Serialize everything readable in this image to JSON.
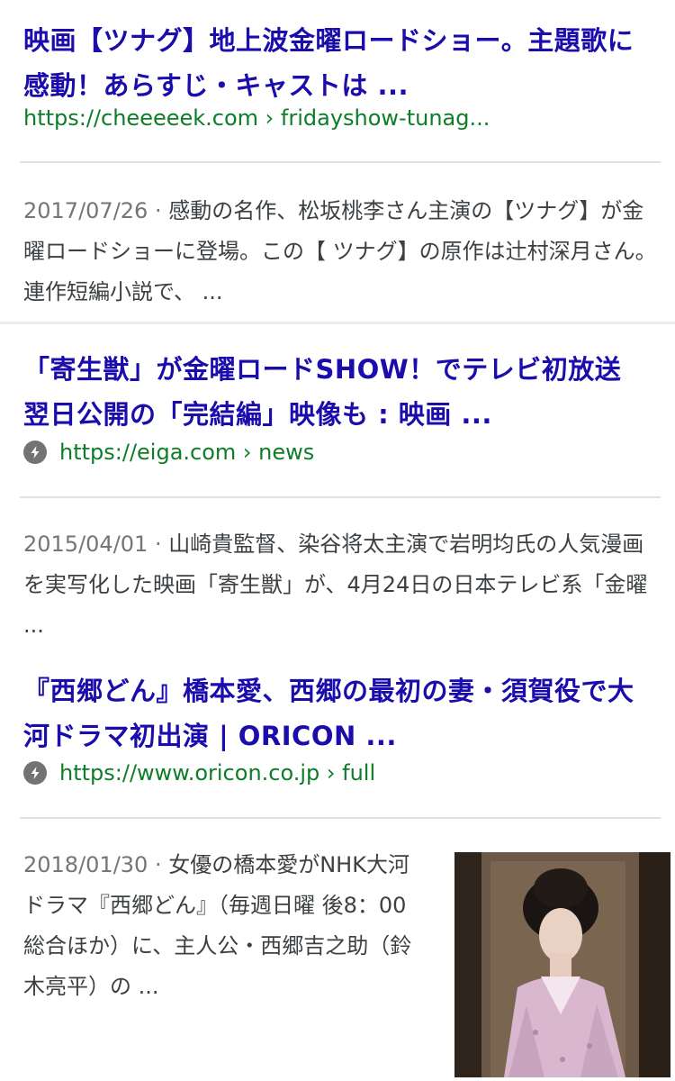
{
  "results": [
    {
      "title": "映画【ツナグ】地上波金曜ロードショー。主題歌に感動！あらすじ・キャストは ...",
      "url": "https://cheeeeek.com › fridayshow-tunag...",
      "date": "2017/07/26 · ",
      "snippet": "感動の名作、松坂桃李さん主演の【ツナグ】が金曜ロードショーに登場。この【 ツナグ】の原作は辻村深月さん。連作短編小説で、 ..."
    },
    {
      "title": "「寄生獣」が金曜ロードSHOW！でテレビ初放送 翌日公開の「完結編」映像も : 映画 ...",
      "url": "https://eiga.com › news",
      "date": "2015/04/01 · ",
      "snippet": "山崎貴監督、染谷将太主演で岩明均氏の人気漫画を実写化した映画「寄生獣」が、4月24日の日本テレビ系「金曜 ..."
    },
    {
      "title": "『西郷どん』橋本愛、西郷の最初の妻・須賀役で大河ドラマ初出演 | ORICON ...",
      "url": "https://www.oricon.co.jp › full",
      "date": "2018/01/30 · ",
      "snippet": "女優の橋本愛がNHK大河ドラマ『西郷どん』（毎週日曜 後8：00 総合ほか）に、主人公・西郷吉之助（鈴木亮平）の ..."
    }
  ],
  "colors": {
    "link": "#1a0dab",
    "url": "#0e7d27",
    "snippet": "#3c4043",
    "date": "#757575",
    "divider": "#e0e0e0",
    "amp_badge": "#737373"
  },
  "icons": {
    "amp": "lightning-bolt-icon"
  }
}
